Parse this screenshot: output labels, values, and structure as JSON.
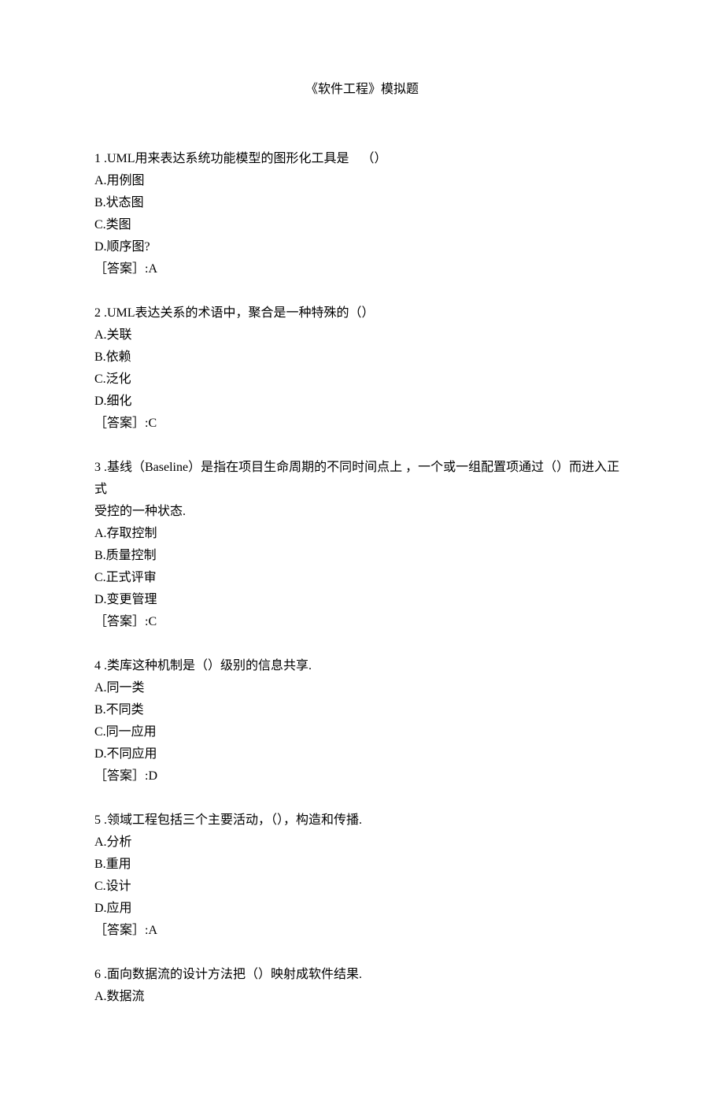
{
  "title": "《软件工程》模拟题",
  "questions": [
    {
      "stem": "1 .UML用来表达系统功能模型的图形化工具是    （）",
      "options": [
        "A.用例图",
        "B.状态图",
        "C.类图",
        "D.顺序图?"
      ],
      "answer": "［答案］:A"
    },
    {
      "stem": "2 .UML表达关系的术语中，聚合是一种特殊的（）",
      "options": [
        "A.关联",
        "B.依赖",
        "C.泛化",
        "D.细化"
      ],
      "answer": "［答案］:C"
    },
    {
      "stem": "3 .基线（Baseline）是指在项目生命周期的不同时间点上 ，一个或一组配置项通过（）而进入正式",
      "stem2": "受控的一种状态.",
      "options": [
        "A.存取控制",
        "B.质量控制",
        "C.正式评审",
        "D.变更管理"
      ],
      "answer": "［答案］:C"
    },
    {
      "stem": "4 .类库这种机制是（）级别的信息共享.",
      "options": [
        "A.同一类",
        "B.不同类",
        "C.同一应用",
        "D.不同应用"
      ],
      "answer": "［答案］:D"
    },
    {
      "stem": "5 .领域工程包括三个主要活动，（），构造和传播.",
      "options": [
        "A.分析",
        "B.重用",
        "C.设计",
        "D.应用"
      ],
      "answer": "［答案］:A"
    },
    {
      "stem": "6 .面向数据流的设计方法把（）映射成软件结果.",
      "options": [
        "A.数据流"
      ],
      "answer": null
    }
  ]
}
